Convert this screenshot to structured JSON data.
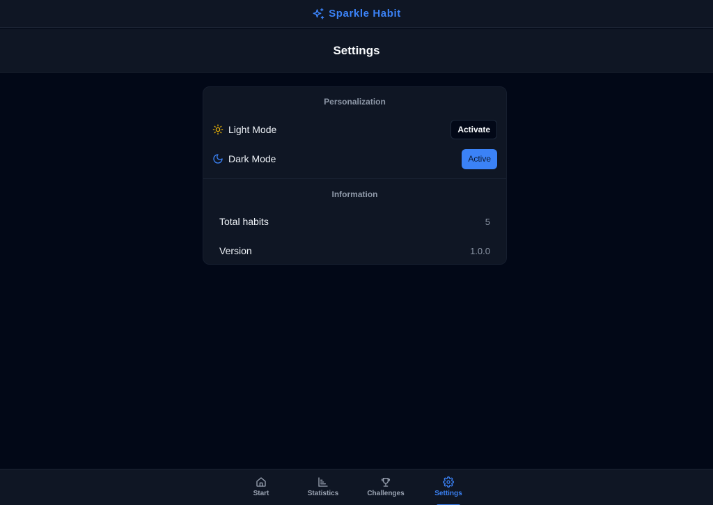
{
  "app": {
    "brand_name": "Sparkle Habit",
    "brand_icon": "sparkles-icon",
    "accent_color": "#3b82f6"
  },
  "header": {
    "title": "Settings"
  },
  "personalization": {
    "title": "Personalization",
    "light_mode": {
      "label": "Light Mode",
      "icon": "sun-icon",
      "button_label": "Activate"
    },
    "dark_mode": {
      "label": "Dark Mode",
      "icon": "moon-icon",
      "button_label": "Active"
    }
  },
  "information": {
    "title": "Information",
    "items": [
      {
        "label": "Total habits",
        "value": "5"
      },
      {
        "label": "Version",
        "value": "1.0.0"
      }
    ]
  },
  "bottom_nav": {
    "items": [
      {
        "label": "Start",
        "icon": "home-icon",
        "active": false
      },
      {
        "label": "Statistics",
        "icon": "bar-chart-icon",
        "active": false
      },
      {
        "label": "Challenges",
        "icon": "trophy-icon",
        "active": false
      },
      {
        "label": "Settings",
        "icon": "gear-icon",
        "active": true
      }
    ]
  }
}
